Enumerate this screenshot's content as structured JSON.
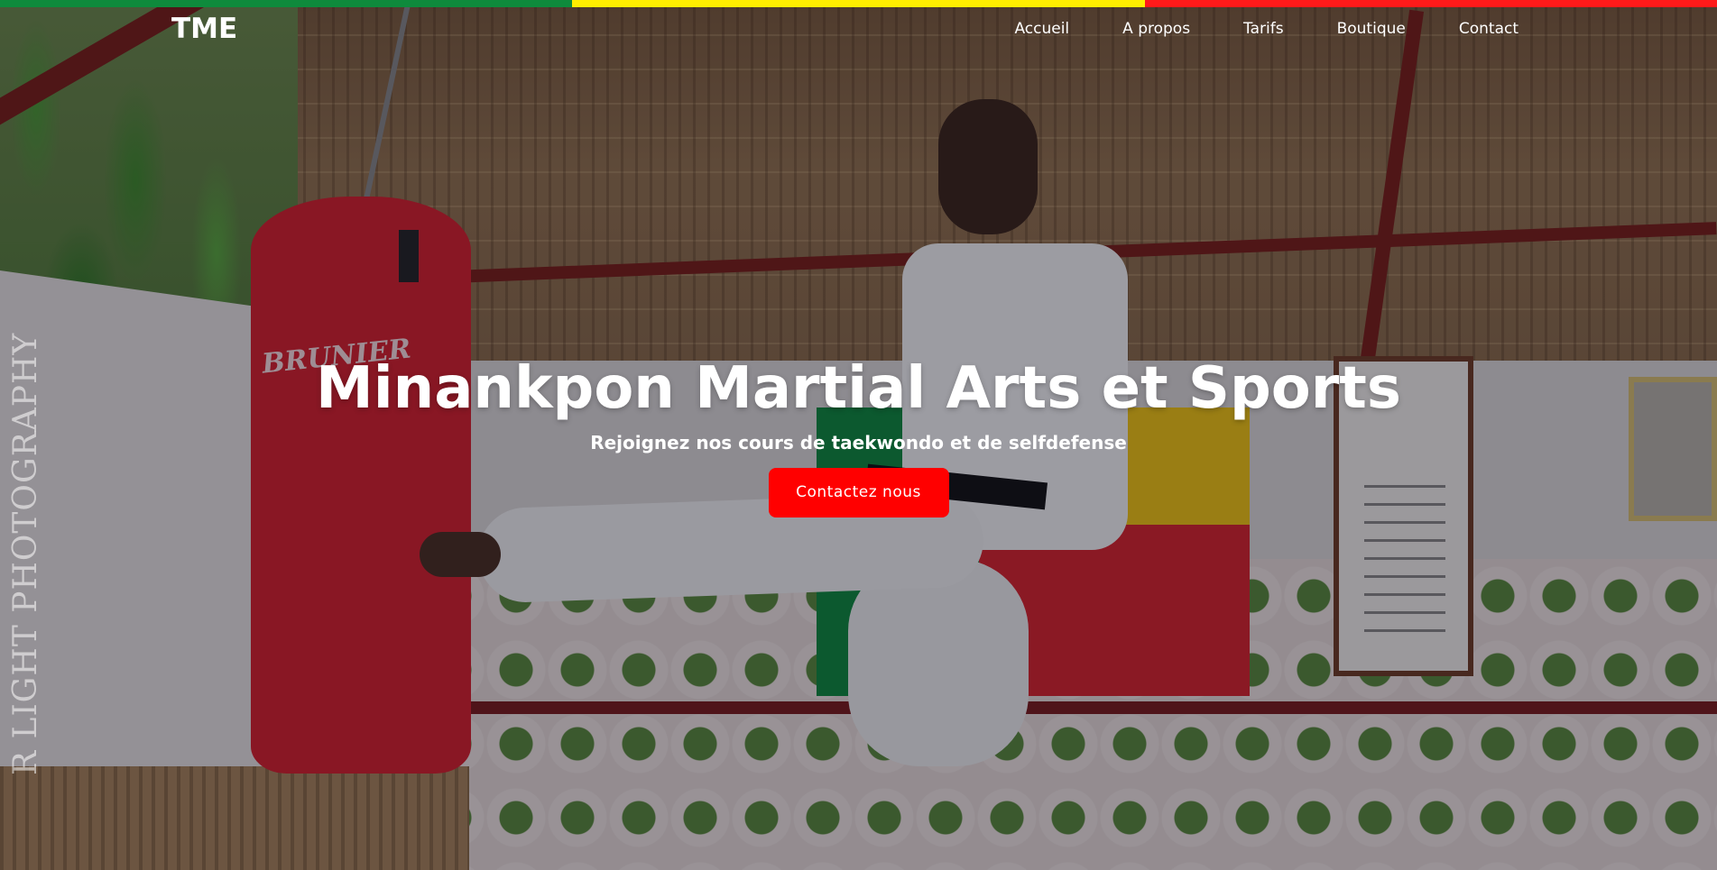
{
  "brand": {
    "logo": "TME"
  },
  "nav": {
    "items": [
      {
        "label": "Accueil"
      },
      {
        "label": "A propos"
      },
      {
        "label": "Tarifs"
      },
      {
        "label": "Boutique"
      },
      {
        "label": "Contact"
      }
    ]
  },
  "stripe": {
    "colors": [
      "#0e8a3c",
      "#ffee00",
      "#ff1a1a"
    ]
  },
  "hero": {
    "title": "Minankpon Martial Arts et Sports",
    "subtitle": "Rejoignez nos cours de taekwondo et de selfdefense",
    "cta_label": "Contactez nous",
    "cta_color": "#ff0000",
    "watermark": "R LIGHT PHOTOGRAPHY",
    "bag_brand": "BRUNIER"
  }
}
